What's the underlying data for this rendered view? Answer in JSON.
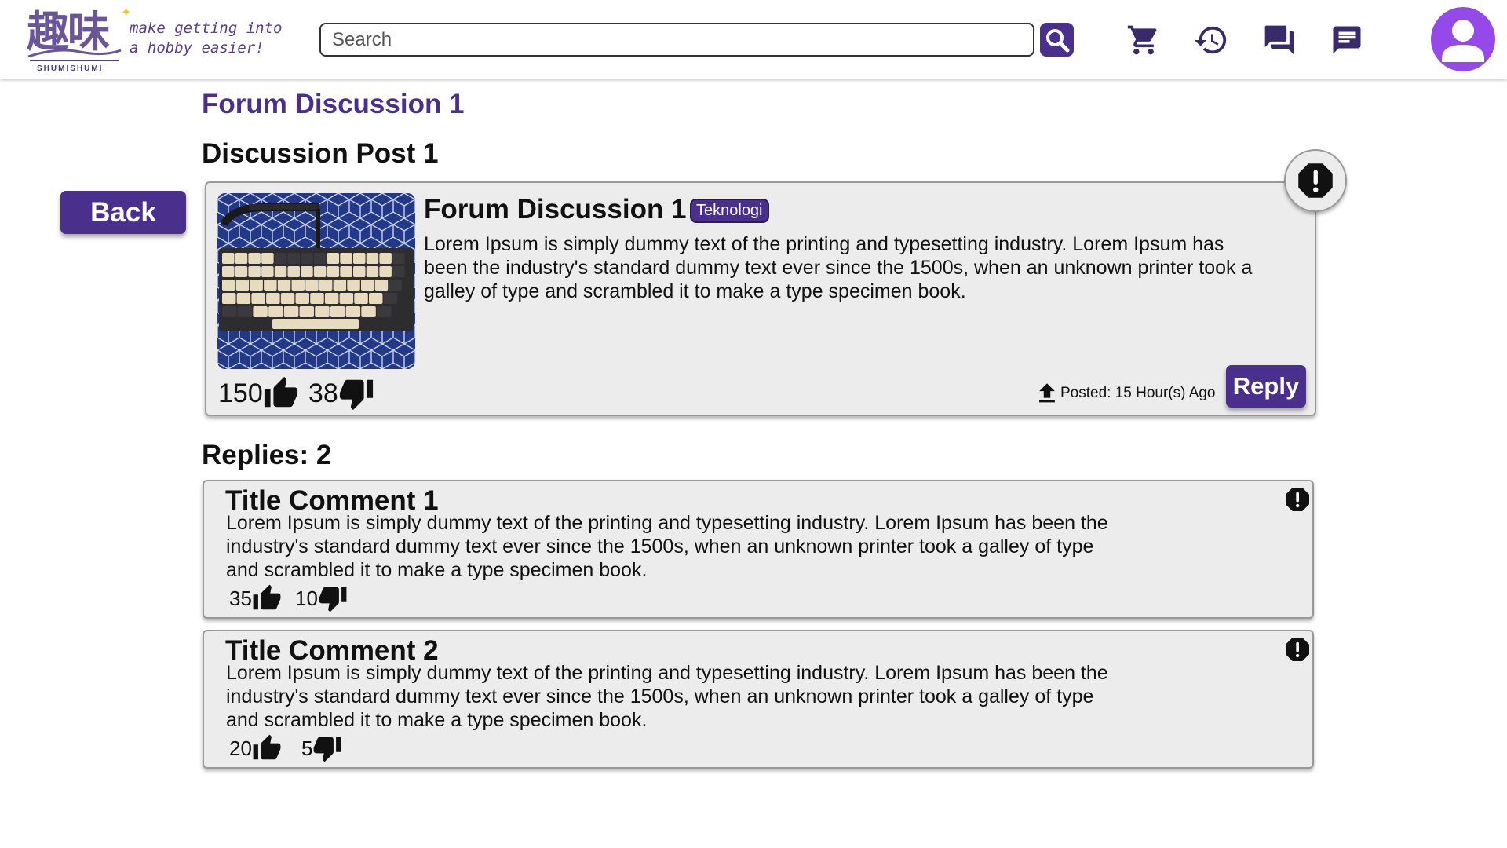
{
  "brand": {
    "logo_text": "趣味",
    "name": "SHUMISHUMI",
    "tagline_line1": "make getting into",
    "tagline_line2": "a hobby easier!"
  },
  "header": {
    "search_placeholder": "Search",
    "icons": [
      "search-icon",
      "cart-icon",
      "history-icon",
      "forum-icon",
      "message-icon",
      "user-avatar-icon"
    ]
  },
  "page": {
    "title": "Forum Discussion 1",
    "section_title": "Discussion Post 1",
    "back_label": "Back",
    "replies_label": "Replies: 2"
  },
  "post": {
    "title": "Forum Discussion 1",
    "tag": "Teknologi",
    "body": "Lorem Ipsum is simply dummy text of the printing and typesetting industry. Lorem Ipsum has been the industry's standard dummy text ever since the 1500s, when an unknown printer took a galley of type and scrambled it to make a type specimen book.",
    "likes": "150",
    "dislikes": "38",
    "posted": "Posted: 15 Hour(s) Ago",
    "reply_label": "Reply"
  },
  "comments": [
    {
      "title": "Title Comment 1",
      "body": "Lorem Ipsum is simply dummy text of the printing and typesetting industry. Lorem Ipsum has been the industry's standard dummy text ever since the 1500s, when an unknown printer took a galley of type and scrambled it to make a type specimen book.",
      "likes": "35",
      "dislikes": "10"
    },
    {
      "title": "Title Comment 2",
      "body": "Lorem Ipsum is simply dummy text of the printing and typesetting industry. Lorem Ipsum has been the industry's standard dummy text ever since the 1500s, when an unknown printer took a galley of type and scrambled it to make a type specimen book.",
      "likes": "20",
      "dislikes": "5"
    }
  ],
  "colors": {
    "accent": "#4b2f8c",
    "avatar": "#9549e8",
    "card_bg": "#ececec"
  }
}
